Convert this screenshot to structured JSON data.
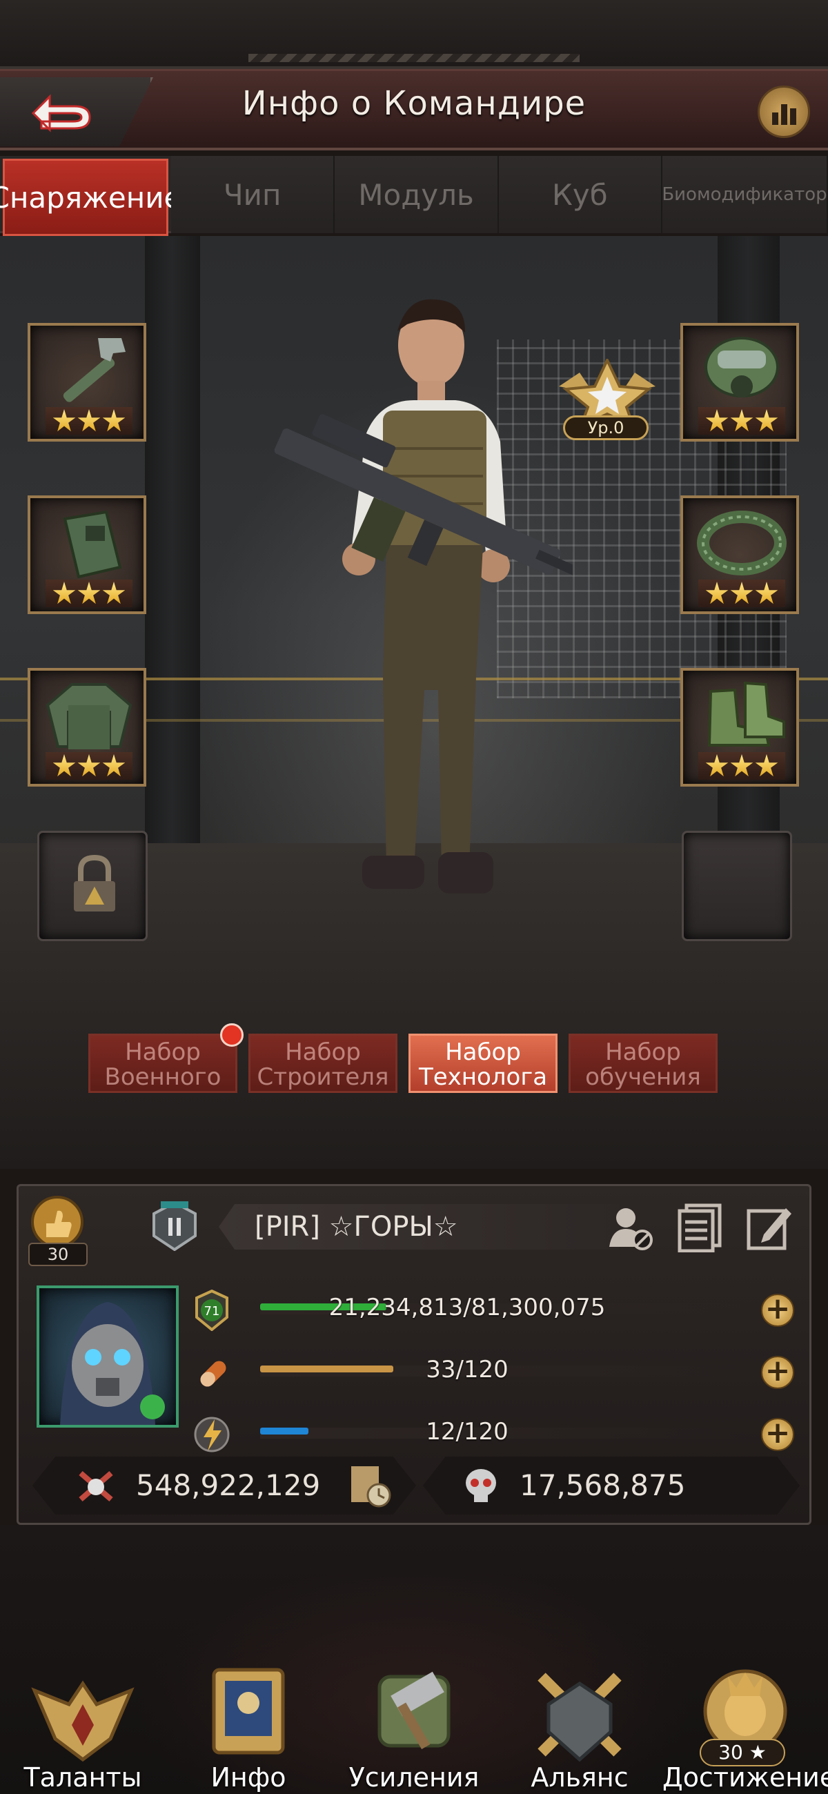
{
  "header": {
    "title": "Инфо о Командире",
    "back_icon": "back-arrow-icon",
    "stats_icon": "bar-chart-icon"
  },
  "tabs": [
    {
      "label": "Снаряжение",
      "active": true
    },
    {
      "label": "Чип",
      "active": false
    },
    {
      "label": "Модуль",
      "active": false
    },
    {
      "label": "Куб",
      "active": false
    },
    {
      "label": "Биомодификатор",
      "active": false
    }
  ],
  "commander": {
    "rank_label": "Ур.0",
    "equipment_left": [
      {
        "item": "wrench-icon",
        "stars": 3
      },
      {
        "item": "armor-plate-icon",
        "stars": 3
      },
      {
        "item": "jacket-icon",
        "stars": 3
      },
      {
        "item": "lock-icon",
        "stars": 0
      }
    ],
    "equipment_right": [
      {
        "item": "gas-mask-icon",
        "stars": 3
      },
      {
        "item": "ring-icon",
        "stars": 3
      },
      {
        "item": "boots-icon",
        "stars": 3
      },
      {
        "item": "empty-slot",
        "stars": 0
      }
    ]
  },
  "sets": [
    {
      "line1": "Набор",
      "line2": "Военного",
      "active": false,
      "notification": true
    },
    {
      "line1": "Набор",
      "line2": "Строителя",
      "active": false,
      "notification": false
    },
    {
      "line1": "Набор",
      "line2": "Технолога",
      "active": true,
      "notification": false
    },
    {
      "line1": "Набор",
      "line2": "обучения",
      "active": false,
      "notification": false
    }
  ],
  "profile": {
    "level": "30",
    "name": "[PIR]  ☆ГОРЫ☆",
    "hero_level": "71",
    "exp_text": "21,234,813/81,300,075",
    "exp_fraction": 0.261,
    "stamina_text": "33/120",
    "stamina_fraction": 0.275,
    "energy_text": "12/120",
    "energy_fraction": 0.1,
    "power": "548,922,129",
    "kills": "17,568,875",
    "colors": {
      "exp": "#2fae3a",
      "stamina": "#c89445",
      "energy": "#1f86d6"
    }
  },
  "nav": [
    {
      "label": "Таланты",
      "icon": "talents-eagle-icon"
    },
    {
      "label": "Инфо",
      "icon": "info-shield-icon"
    },
    {
      "label": "Усиления",
      "icon": "hammer-icon"
    },
    {
      "label": "Альянс",
      "icon": "crossed-swords-icon"
    },
    {
      "label": "Достижение",
      "icon": "lion-trophy-icon"
    }
  ],
  "achievement_count": "30 ★"
}
